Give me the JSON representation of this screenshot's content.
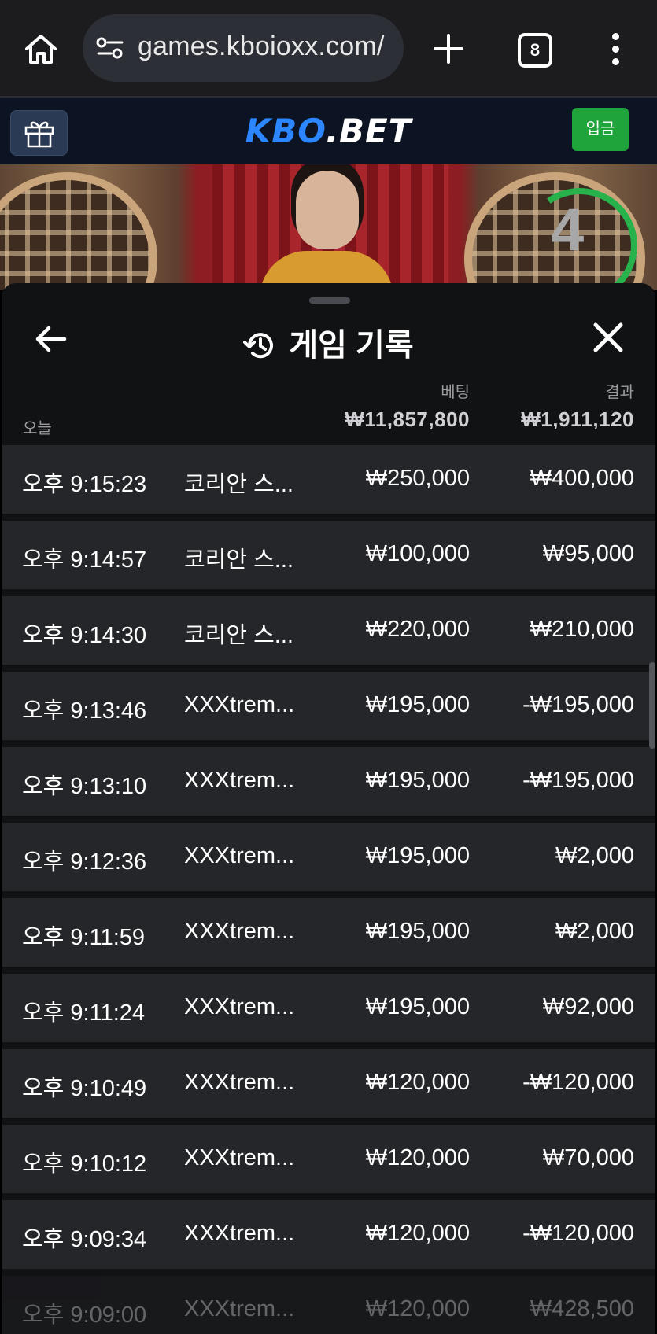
{
  "browser": {
    "url": "games.kboioxx.com/",
    "tab_count": "8"
  },
  "site": {
    "logo_kbo": "KBO",
    "logo_dot": ".",
    "logo_bet": "BET",
    "deposit_label": "입금"
  },
  "video": {
    "countdown": "4"
  },
  "history": {
    "title": "게임 기록",
    "bet_header": "베팅",
    "result_header": "결과",
    "today_label": "오늘",
    "total_bet": "₩11,857,800",
    "total_result": "₩1,911,120",
    "rows": [
      {
        "time": "오후 9:15:23",
        "game": "코리안 스...",
        "bet": "₩250,000",
        "result": "₩400,000"
      },
      {
        "time": "오후 9:14:57",
        "game": "코리안 스...",
        "bet": "₩100,000",
        "result": "₩95,000"
      },
      {
        "time": "오후 9:14:30",
        "game": "코리안 스...",
        "bet": "₩220,000",
        "result": "₩210,000"
      },
      {
        "time": "오후 9:13:46",
        "game": "XXXtrem...",
        "bet": "₩195,000",
        "result": "-₩195,000"
      },
      {
        "time": "오후 9:13:10",
        "game": "XXXtrem...",
        "bet": "₩195,000",
        "result": "-₩195,000"
      },
      {
        "time": "오후 9:12:36",
        "game": "XXXtrem...",
        "bet": "₩195,000",
        "result": "₩2,000"
      },
      {
        "time": "오후 9:11:59",
        "game": "XXXtrem...",
        "bet": "₩195,000",
        "result": "₩2,000"
      },
      {
        "time": "오후 9:11:24",
        "game": "XXXtrem...",
        "bet": "₩195,000",
        "result": "₩92,000"
      },
      {
        "time": "오후 9:10:49",
        "game": "XXXtrem...",
        "bet": "₩120,000",
        "result": "-₩120,000"
      },
      {
        "time": "오후 9:10:12",
        "game": "XXXtrem...",
        "bet": "₩120,000",
        "result": "₩70,000"
      },
      {
        "time": "오후 9:09:34",
        "game": "XXXtrem...",
        "bet": "₩120,000",
        "result": "-₩120,000"
      },
      {
        "time": "오후 9:09:00",
        "game": "XXXtrem...",
        "bet": "₩120,000",
        "result": "₩428,500"
      }
    ]
  },
  "colors": {
    "accent_logo": "#2b86ff",
    "deposit_green": "#1ea43a",
    "timer_green": "#27b24b",
    "row_bg": "#25262a"
  },
  "icons": [
    "home-icon",
    "site-settings-icon",
    "new-tab-plus-icon",
    "tab-switcher-icon",
    "more-menu-icon",
    "gift-icon",
    "history-icon",
    "back-arrow-icon",
    "close-icon"
  ]
}
